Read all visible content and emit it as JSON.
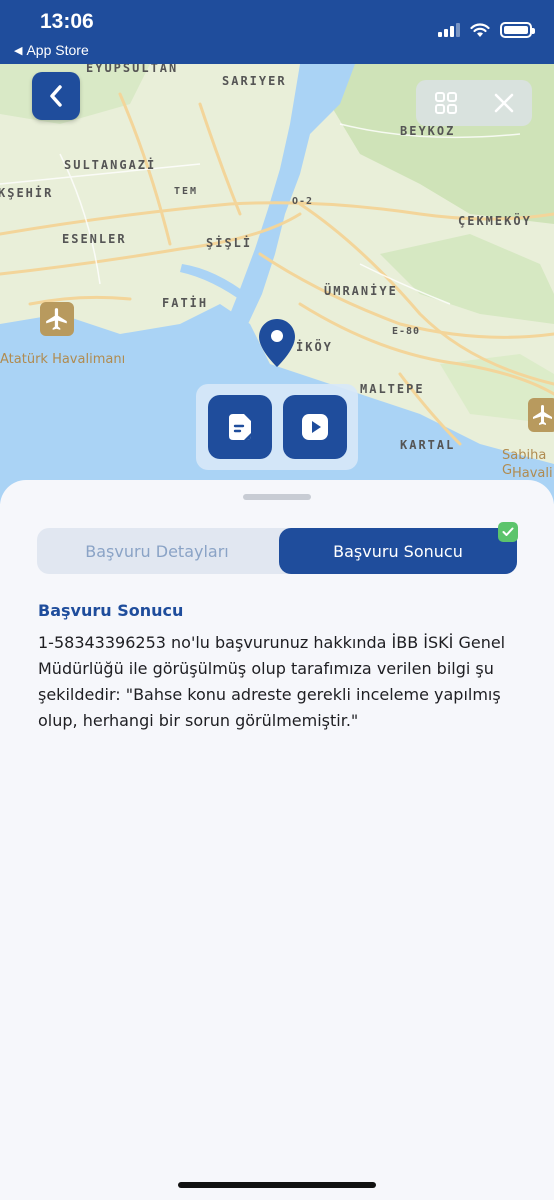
{
  "status_bar": {
    "time": "13:06",
    "back_app": "App Store"
  },
  "map": {
    "labels": {
      "eyupsultan": "EYÜPSULTAN",
      "sariyer": "SARIYER",
      "beykoz": "BEYKOZ",
      "sultangazi": "SULTANGAZİ",
      "eskisehir": "KŞEHİR",
      "tem": "TEM",
      "o2": "O-2",
      "cekmekoy": "ÇEKMEKÖY",
      "esenler": "ESENLER",
      "sisli": "ŞİŞLİ",
      "fatih": "FATİH",
      "umraniye": "ÜMRANİYE",
      "e80": "E-80",
      "kadikoy": "İKÖY",
      "maltepe": "MALTEPE",
      "kartal": "KARTAL",
      "ataturk": "Atatürk Havalimanı",
      "sabiha1": "Sabiha G",
      "sabiha2": "Havali"
    }
  },
  "tabs": {
    "details": "Başvuru Detayları",
    "result": "Başvuru Sonucu"
  },
  "result": {
    "title": "Başvuru Sonucu",
    "text": "1-58343396253 no'lu başvurunuz hakkında İBB İSKİ Genel Müdürlüğü ile görüşülmüş olup tarafımıza verilen bilgi şu şekildedir: \"Bahse konu adreste gerekli inceleme yapılmış olup, herhangi bir sorun görülmemiştir.\""
  },
  "colors": {
    "primary": "#1f4d9c",
    "success": "#5cc46c",
    "water": "#aad3f5",
    "land": "#e9efd9"
  }
}
